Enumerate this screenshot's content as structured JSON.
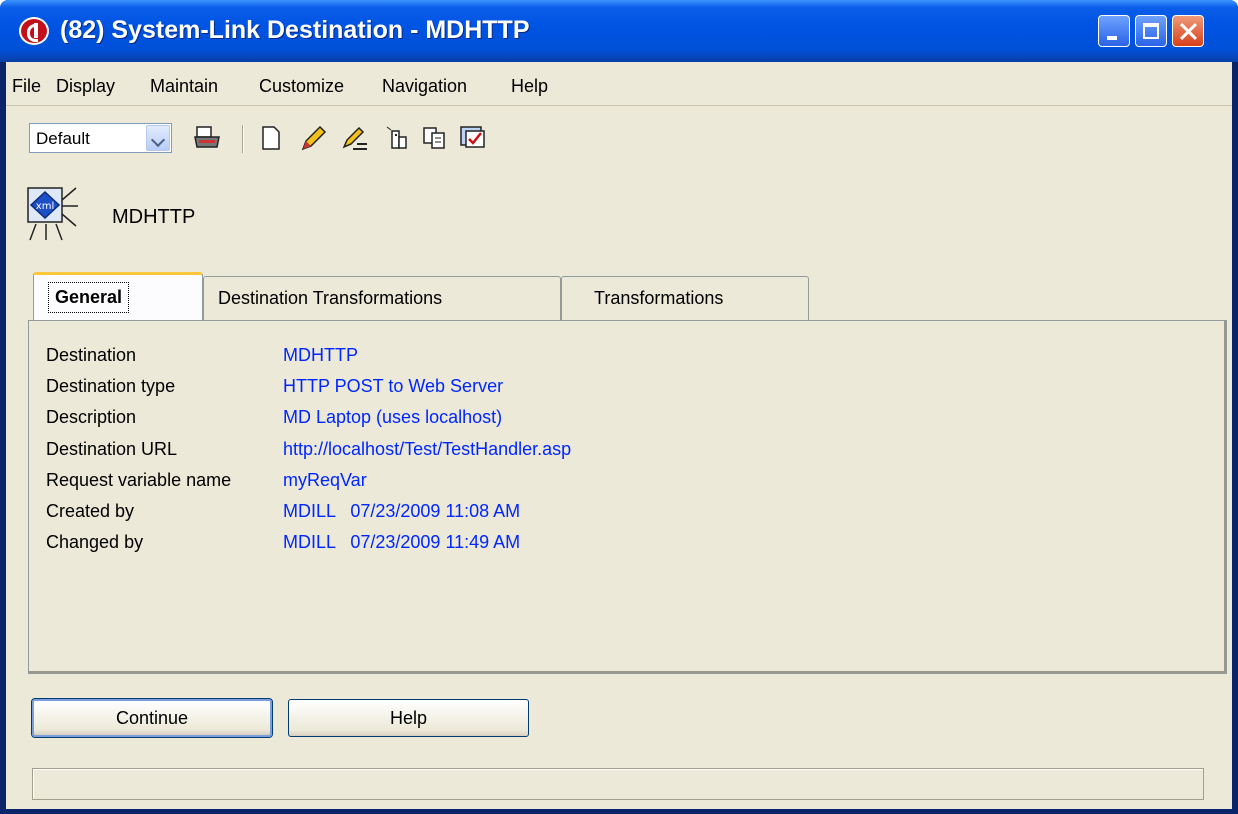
{
  "window": {
    "title": "(82) System-Link Destination - MDHTTP",
    "controls": {
      "minimize": "minimize-icon",
      "maximize": "maximize-icon",
      "close": "close-icon"
    }
  },
  "menu": [
    "File",
    "Display",
    "Maintain",
    "Customize",
    "Navigation",
    "Help"
  ],
  "toolbar": {
    "view_select": "Default",
    "icons": [
      "printer-icon",
      "new-document-icon",
      "edit-pencil-icon",
      "edit-list-icon",
      "copy-icon",
      "paste-icon",
      "approve-icon"
    ]
  },
  "header": {
    "icon": "xml-destination-icon",
    "name": "MDHTTP"
  },
  "tabs": [
    "General",
    "Destination Transformations",
    "Transformations"
  ],
  "active_tab": "General",
  "details": [
    {
      "label": "Destination",
      "value": "MDHTTP"
    },
    {
      "label": "Destination type",
      "value": "HTTP POST to Web Server"
    },
    {
      "label": "Description",
      "value": "MD Laptop (uses localhost)"
    },
    {
      "label": "Destination URL",
      "value": "http://localhost/Test/TestHandler.asp"
    },
    {
      "label": "Request variable name",
      "value": "myReqVar"
    },
    {
      "label": "Created by",
      "value": "MDILL   07/23/2009 11:08 AM"
    },
    {
      "label": "Changed by",
      "value": "MDILL   07/23/2009 11:49 AM"
    }
  ],
  "buttons": {
    "continue": "Continue",
    "help": "Help"
  },
  "colors": {
    "value_text": "#0026ff",
    "titlebar": "#0054e3",
    "face": "#ece9d8"
  }
}
